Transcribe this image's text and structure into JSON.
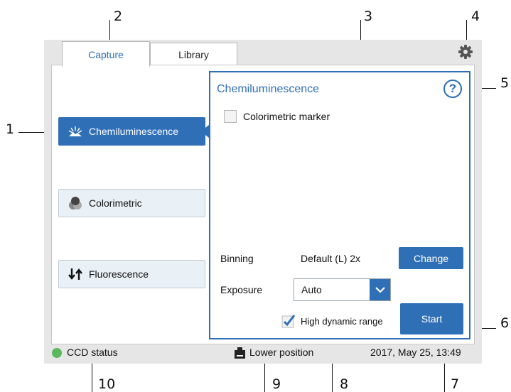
{
  "tabs": [
    {
      "label": "Capture",
      "active": true
    },
    {
      "label": "Library",
      "active": false
    }
  ],
  "modes": [
    {
      "label": "Chemiluminescence",
      "icon": "chemiluminescence-icon",
      "active": true
    },
    {
      "label": "Colorimetric",
      "icon": "colorimetric-icon",
      "active": false
    },
    {
      "label": "Fluorescence",
      "icon": "fluorescence-icon",
      "active": false
    }
  ],
  "panel": {
    "title": "Chemiluminescence",
    "help_label": "?",
    "colorimetric_marker": {
      "label": "Colorimetric marker",
      "checked": false
    },
    "binning": {
      "label": "Binning",
      "value": "Default (L) 2x",
      "button": "Change"
    },
    "exposure": {
      "label": "Exposure",
      "value": "Auto"
    },
    "high_dynamic_range": {
      "label": "High dynamic range",
      "checked": true
    },
    "start_button": "Start"
  },
  "status_bar": {
    "ccd_status": "CCD status",
    "ccd_color": "#5cb85c",
    "position": "Lower position",
    "datetime": "2017, May 25, 13:49"
  },
  "callouts": [
    "1",
    "2",
    "3",
    "4",
    "5",
    "6",
    "7",
    "8",
    "9",
    "10"
  ],
  "colors": {
    "accent": "#2f6fb6",
    "frame": "#e6e6e6"
  }
}
